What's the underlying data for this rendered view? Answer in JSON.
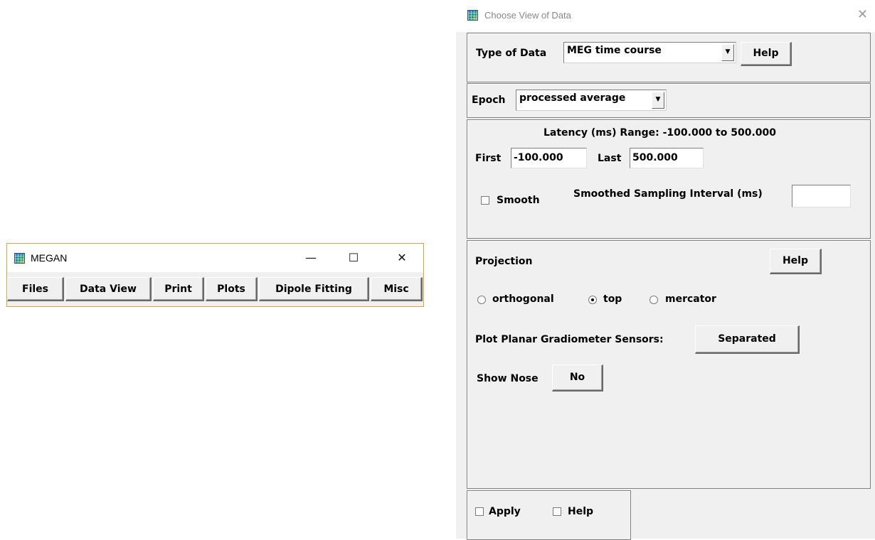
{
  "megan": {
    "title": "MEGAN",
    "controls": {
      "minimize": "—",
      "maximize": "☐",
      "close": "✕"
    },
    "menu": [
      "Files",
      "Data View",
      "Print",
      "Plots",
      "Dipole Fitting",
      "Misc"
    ]
  },
  "dialog": {
    "title": "Choose View of Data",
    "close": "✕",
    "type_of_data": {
      "label": "Type of Data",
      "value": "MEG time course",
      "help": "Help"
    },
    "epoch": {
      "label": "Epoch",
      "value": "processed average"
    },
    "latency": {
      "range_text": "Latency (ms) Range: -100.000 to 500.000",
      "first_label": "First",
      "first_value": "-100.000",
      "last_label": "Last",
      "last_value": "500.000",
      "smooth_label": "Smooth",
      "smooth_interval_label": "Smoothed Sampling Interval (ms)",
      "smooth_interval_value": ""
    },
    "projection": {
      "label": "Projection",
      "help": "Help",
      "options": [
        "orthogonal",
        "top",
        "mercator"
      ],
      "selected": "top",
      "gradiometer_label": "Plot Planar Gradiometer Sensors:",
      "gradiometer_value": "Separated",
      "nose_label": "Show Nose",
      "nose_value": "No"
    },
    "footer": {
      "apply": "Apply",
      "help": "Help"
    }
  }
}
